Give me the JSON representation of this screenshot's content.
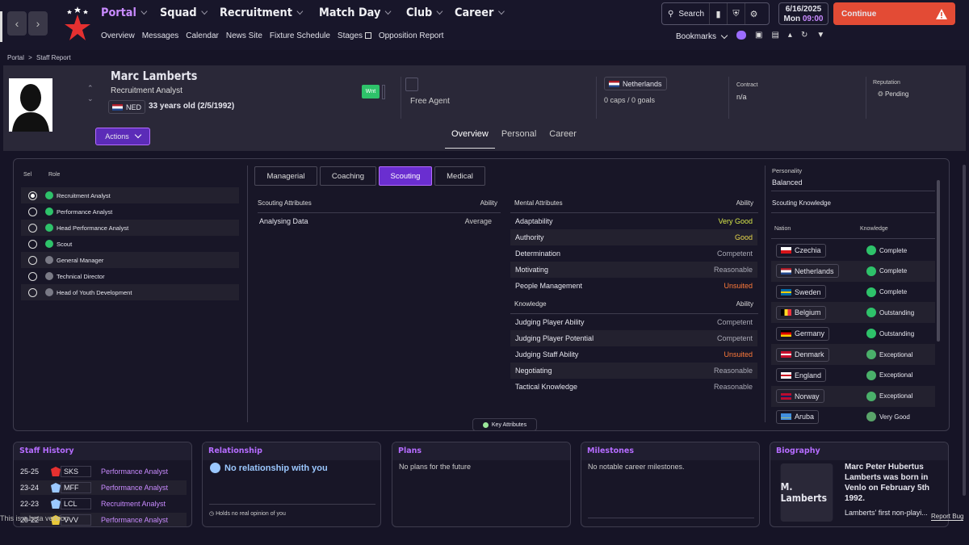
{
  "nav": {
    "menu": [
      "Portal",
      "Squad",
      "Recruitment",
      "Match Day",
      "Club",
      "Career"
    ],
    "submenu": [
      "Overview",
      "Messages",
      "Calendar",
      "News Site",
      "Fixture Schedule",
      "Stages",
      "Opposition Report"
    ],
    "search_label": "Search",
    "date": "6/16/2025",
    "day": "Mon",
    "time": "09:00",
    "continue_label": "Continue",
    "bookmarks_label": "Bookmarks",
    "accent_color": "#c98bff",
    "continue_color": "#e34b35"
  },
  "breadcrumb": {
    "root": "Portal",
    "sep": ">",
    "current": "Staff Report"
  },
  "profile": {
    "name": "Marc Lamberts",
    "role": "Recruitment Analyst",
    "nationality": "NED",
    "age_text": "33 years old (2/5/1992)",
    "wnt": "Wnt",
    "status": "Free Agent",
    "country": "Netherlands",
    "caps": "0 caps / 0 goals",
    "contract_label": "Contract",
    "contract_value": "n/a",
    "reputation_label": "Reputation",
    "reputation_value": "Pending",
    "actions_label": "Actions",
    "tabs": [
      "Overview",
      "Personal",
      "Career"
    ]
  },
  "roles": {
    "header_sel": "Sel",
    "header_role": "Role",
    "items": [
      {
        "label": "Recruitment Analyst",
        "selected": true,
        "dot": "#2ec26a"
      },
      {
        "label": "Performance Analyst",
        "selected": false,
        "dot": "#2ec26a"
      },
      {
        "label": "Head Performance Analyst",
        "selected": false,
        "dot": "#2ec26a"
      },
      {
        "label": "Scout",
        "selected": false,
        "dot": "#2ec26a"
      },
      {
        "label": "General Manager",
        "selected": false,
        "dot": "#7a7a86"
      },
      {
        "label": "Technical Director",
        "selected": false,
        "dot": "#7a7a86"
      },
      {
        "label": "Head of Youth Development",
        "selected": false,
        "dot": "#7a7a86"
      }
    ]
  },
  "attr_tabs": [
    "Managerial",
    "Coaching",
    "Scouting",
    "Medical"
  ],
  "scouting": {
    "title": "Scouting Attributes",
    "ability_label": "Ability",
    "rows": [
      {
        "name": "Analysing Data",
        "value": "Average"
      }
    ]
  },
  "mental": {
    "title": "Mental Attributes",
    "ability_label": "Ability",
    "rows": [
      {
        "name": "Adaptability",
        "value": "Very Good"
      },
      {
        "name": "Authority",
        "value": "Good"
      },
      {
        "name": "Determination",
        "value": "Competent"
      },
      {
        "name": "Motivating",
        "value": "Reasonable"
      },
      {
        "name": "People Management",
        "value": "Unsuited"
      }
    ]
  },
  "knowledge": {
    "title": "Knowledge",
    "ability_label": "Ability",
    "rows": [
      {
        "name": "Judging Player Ability",
        "value": "Competent"
      },
      {
        "name": "Judging Player Potential",
        "value": "Competent"
      },
      {
        "name": "Judging Staff Ability",
        "value": "Unsuited"
      },
      {
        "name": "Negotiating",
        "value": "Reasonable"
      },
      {
        "name": "Tactical Knowledge",
        "value": "Reasonable"
      }
    ]
  },
  "personality": {
    "label": "Personality",
    "value": "Balanced"
  },
  "scouting_knowledge": {
    "title": "Scouting Knowledge",
    "col_nation": "Nation",
    "col_knowledge": "Knowledge",
    "rows": [
      {
        "nation": "Czechia",
        "level": "Complete"
      },
      {
        "nation": "Netherlands",
        "level": "Complete"
      },
      {
        "nation": "Sweden",
        "level": "Complete"
      },
      {
        "nation": "Belgium",
        "level": "Outstanding"
      },
      {
        "nation": "Germany",
        "level": "Outstanding"
      },
      {
        "nation": "Denmark",
        "level": "Exceptional"
      },
      {
        "nation": "England",
        "level": "Exceptional"
      },
      {
        "nation": "Norway",
        "level": "Exceptional"
      },
      {
        "nation": "Aruba",
        "level": "Very Good"
      }
    ]
  },
  "key_attributes_label": "Key Attributes",
  "staff_history": {
    "title": "Staff History",
    "rows": [
      {
        "season": "25-25",
        "club": "SKS",
        "role": "Performance Analyst"
      },
      {
        "season": "23-24",
        "club": "MFF",
        "role": "Performance Analyst"
      },
      {
        "season": "22-23",
        "club": "LCL",
        "role": "Recruitment Analyst"
      },
      {
        "season": "20-22",
        "club": "VVV",
        "role": "Performance Analyst"
      }
    ]
  },
  "relationship": {
    "title": "Relationship",
    "text": "No relationship with you",
    "note": "Holds no real opinion of you"
  },
  "plans": {
    "title": "Plans",
    "text": "No plans for the future"
  },
  "milestones": {
    "title": "Milestones",
    "text": "No notable career milestones."
  },
  "biography": {
    "title": "Biography",
    "image_text": "M. Lamberts",
    "text": "Marc Peter Hubertus Lamberts was born in Venlo on February 5th 1992.",
    "text2": "Lamberts' first non-playi..."
  },
  "footer": {
    "left_text": "This is a beta version",
    "report_bug": "Report Bug"
  }
}
